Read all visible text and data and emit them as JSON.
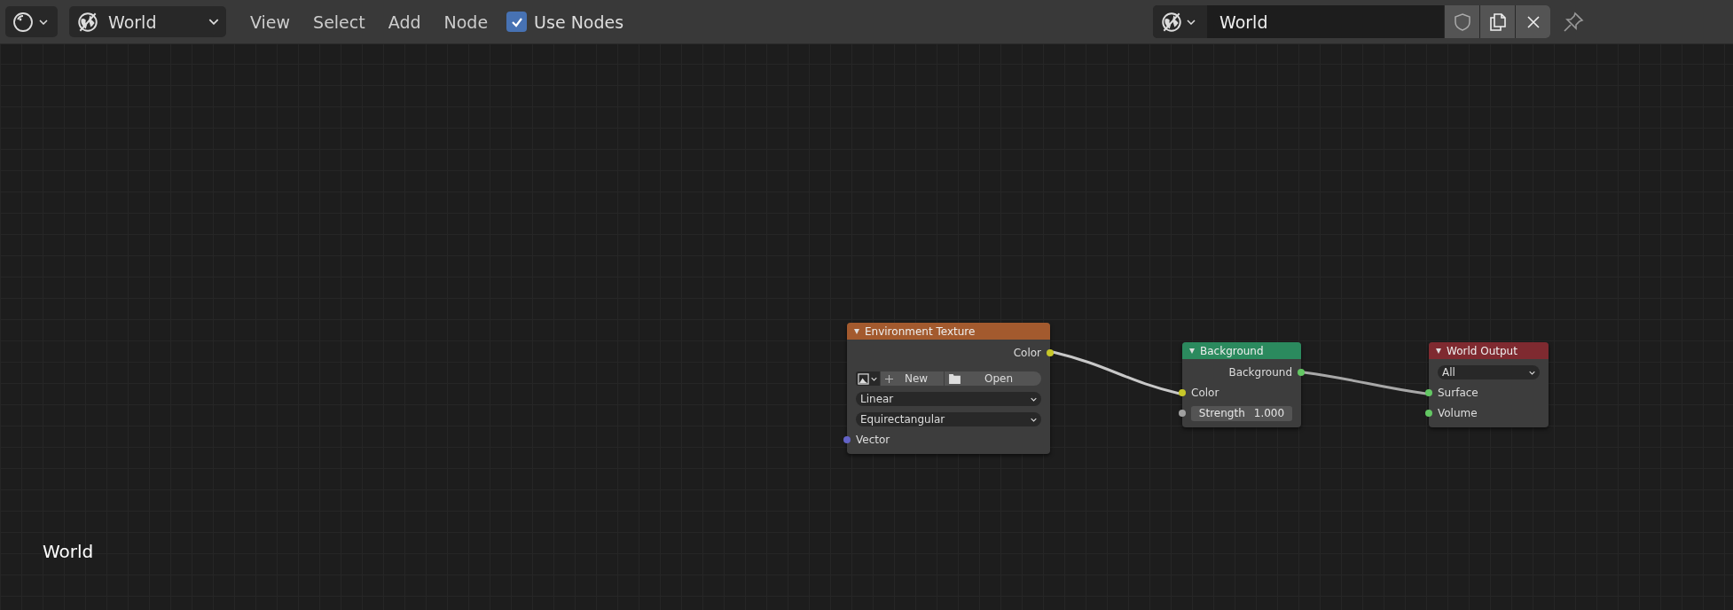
{
  "header": {
    "world_selector": {
      "value": "World"
    },
    "menus": [
      "View",
      "Select",
      "Add",
      "Node"
    ],
    "use_nodes": {
      "label": "Use Nodes",
      "checked": true
    },
    "datablock": {
      "name": "World",
      "fake_user": false,
      "pinned": false
    }
  },
  "nodes": [
    {
      "title": "Environment Texture",
      "color": "#a35a2e",
      "expanded": true,
      "rows": [
        {
          "kind": "output",
          "label": "Color",
          "color": "#c7c729"
        },
        {
          "kind": "image_buttons",
          "new_label": "New",
          "open_label": "Open"
        },
        {
          "kind": "dropdown",
          "value": "Linear"
        },
        {
          "kind": "dropdown",
          "value": "Equirectangular"
        },
        {
          "kind": "input",
          "label": "Vector",
          "color": "#6363c7"
        }
      ]
    },
    {
      "title": "Background",
      "color": "#2b8a5e",
      "expanded": true,
      "rows": [
        {
          "kind": "output",
          "label": "Background",
          "color": "#63c763"
        },
        {
          "kind": "input",
          "label": "Color",
          "color": "#c7c729"
        },
        {
          "kind": "value_field",
          "label": "Strength",
          "value": "1.000",
          "color": "#a1a1a1"
        }
      ]
    },
    {
      "title": "World Output",
      "color": "#7f2a30",
      "expanded": true,
      "rows": [
        {
          "kind": "dropdown",
          "value": "All"
        },
        {
          "kind": "input",
          "label": "Surface",
          "color": "#63c763"
        },
        {
          "kind": "input",
          "label": "Volume",
          "color": "#63c763"
        }
      ]
    }
  ],
  "canvas_label": "World"
}
